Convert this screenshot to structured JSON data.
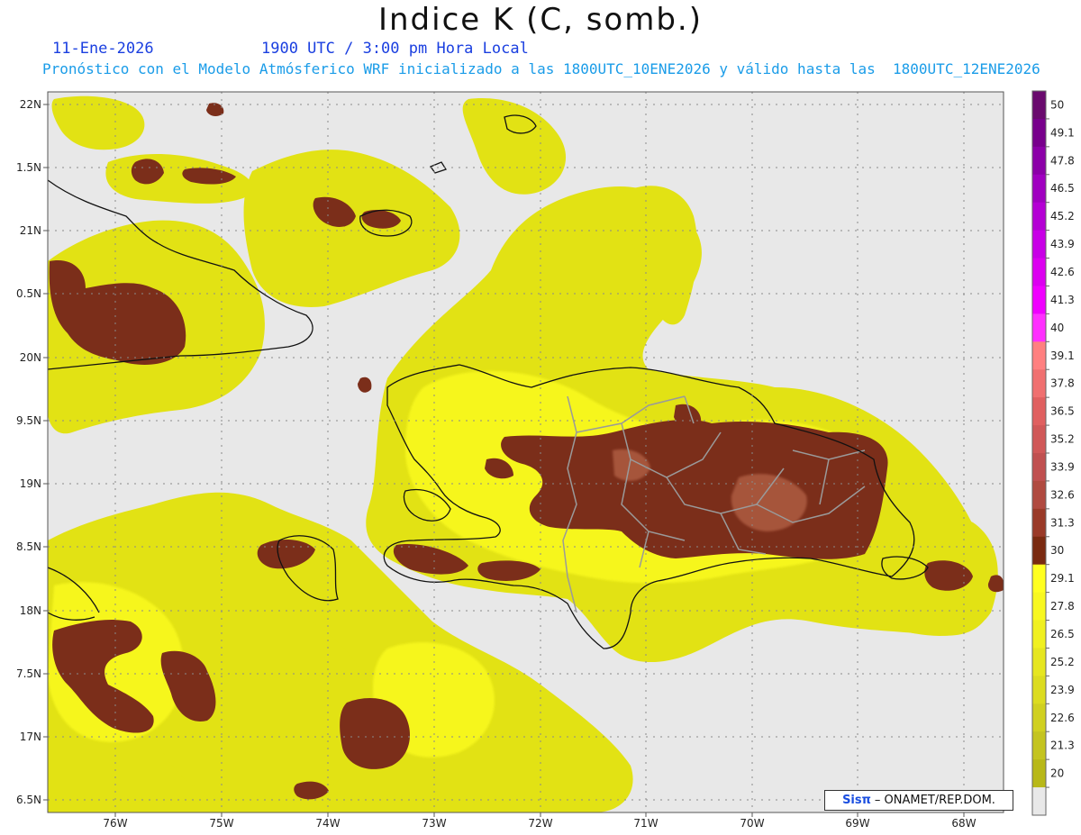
{
  "title": "Indice K (C, somb.)",
  "date_label": "11-Ene-2026",
  "time_label": "1900 UTC / 3:00 pm Hora Local",
  "forecast_label": "Pronóstico con el Modelo Atmósferico WRF inicializado a las 1800UTC_10ENE2026 y válido hasta las  1800UTC_12ENE2026",
  "credit": {
    "brand": "Sisπ",
    "text": "– ONAMET/REP.DOM."
  },
  "map": {
    "lon_range": [
      -76.6,
      -67.6
    ],
    "lat_range": [
      6.45,
      22.1
    ],
    "lon_ticks": [
      "76W",
      "75W",
      "74W",
      "73W",
      "72W",
      "71W",
      "70W",
      "69W",
      "68W"
    ],
    "lat_ticks": [
      "22N",
      "1.5N",
      "21N",
      "0.5N",
      "20N",
      "9.5N",
      "19N",
      "8.5N",
      "18N",
      "7.5N",
      "17N",
      "6.5N"
    ],
    "background_color": "#e8e8e8",
    "gridlines": true
  },
  "colorbar": {
    "labels": [
      "50",
      "49.1",
      "47.8",
      "46.5",
      "45.2",
      "43.9",
      "42.6",
      "41.3",
      "40",
      "39.1",
      "37.8",
      "36.5",
      "35.2",
      "33.9",
      "32.6",
      "31.3",
      "30",
      "29.1",
      "27.8",
      "26.5",
      "25.2",
      "23.9",
      "22.6",
      "21.3",
      "20"
    ],
    "colors": [
      "#6a0a6e",
      "#78008c",
      "#8c00a8",
      "#a000c0",
      "#b400d4",
      "#c800e6",
      "#dc00f0",
      "#f000ff",
      "#ff30ff",
      "#ff8080",
      "#f07070",
      "#e06060",
      "#d05858",
      "#c05050",
      "#b04a40",
      "#9a3a28",
      "#7a2a10",
      "#ffff20",
      "#f8f820",
      "#f0f020",
      "#e6e620",
      "#dcdc20",
      "#d0d020",
      "#c4c420",
      "#b8b818",
      "#e8e8e8"
    ]
  },
  "legend_regions": {
    "low_color": "#e8e8e8",
    "yellow_color": "#e4e40a",
    "brown_color": "#7b2e1a"
  }
}
